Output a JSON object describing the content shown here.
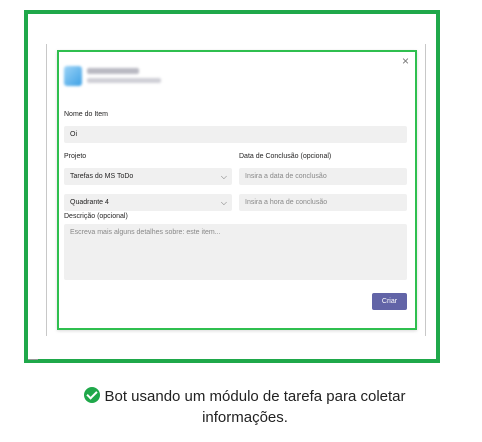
{
  "dialog": {
    "close_glyph": "×",
    "fields": {
      "item_name_label": "Nome do Item",
      "item_name_value": "Oi",
      "project_label": "Projeto",
      "project_value": "Tarefas do MS ToDo",
      "quadrant_value": "Quadrante 4",
      "due_label": "Data de Conclusão (opcional)",
      "due_date_placeholder": "Insira a data de conclusão",
      "due_time_placeholder": "Insira a hora de conclusão",
      "description_label": "Descrição (opcional)",
      "description_placeholder": "Escreva mais alguns detalhes sobre: este item..."
    },
    "create_button": "Criar",
    "chevron_glyph": "⌵"
  },
  "caption": {
    "text": "Bot usando um módulo de tarefa para coletar informações."
  },
  "colors": {
    "frame_green": "#1fa84a",
    "button_purple": "#6264a7",
    "field_bg": "#f0f0f0"
  }
}
